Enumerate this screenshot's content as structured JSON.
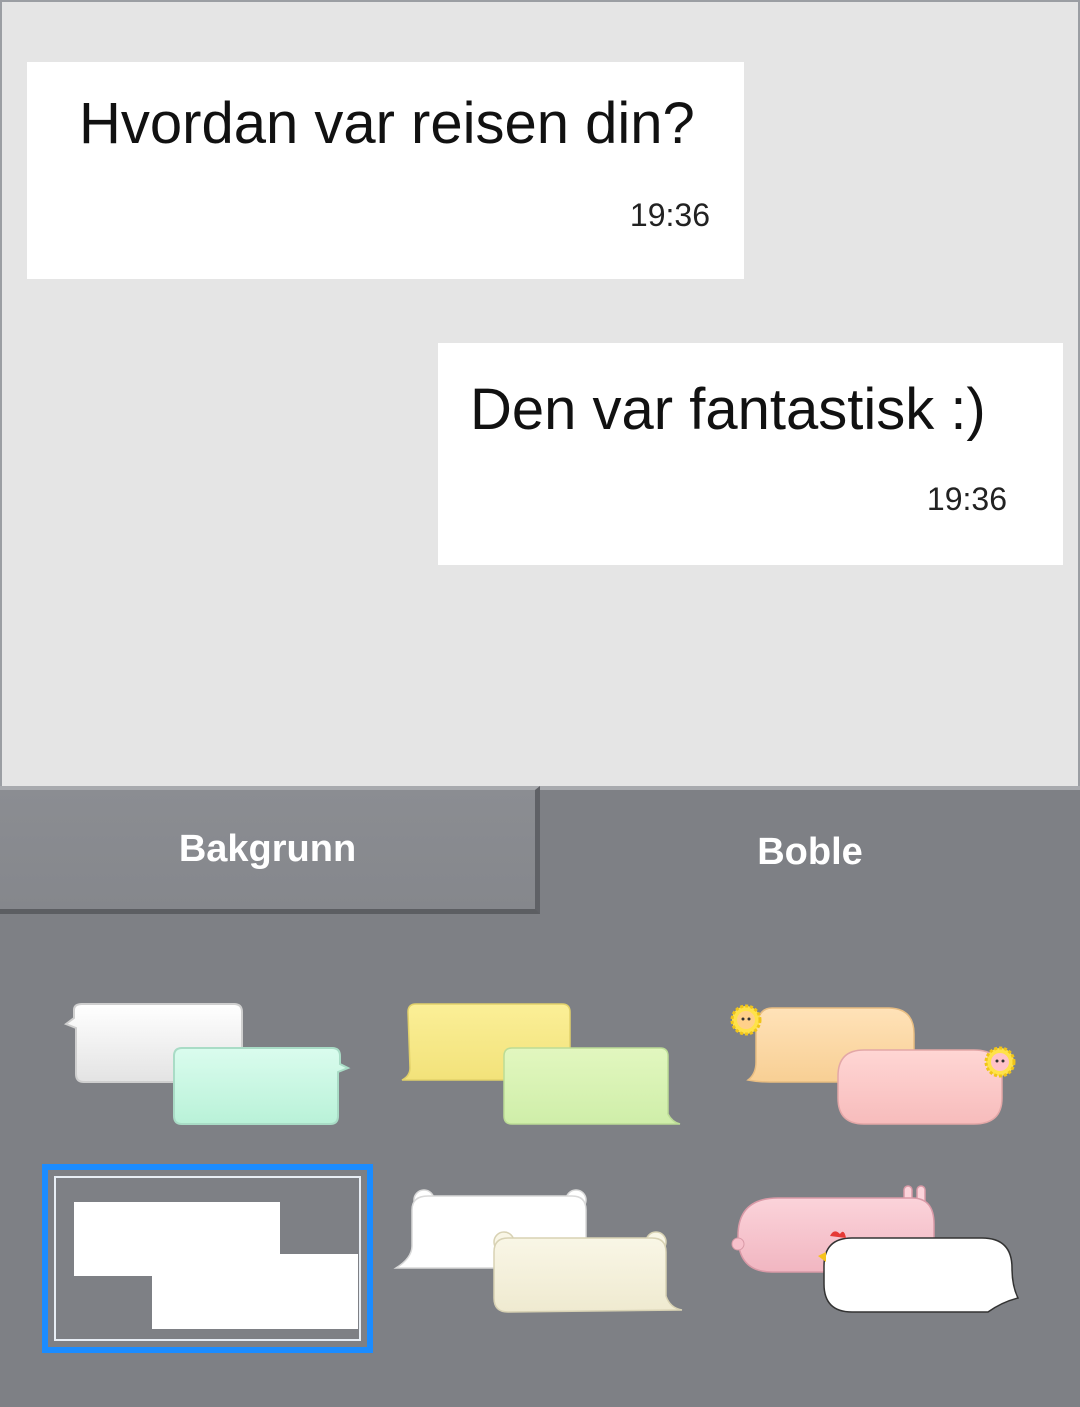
{
  "chat": {
    "messages": [
      {
        "text": "Hvordan var reisen din?",
        "time": "19:36"
      },
      {
        "text": "Den var fantastisk :)",
        "time": "19:36"
      }
    ]
  },
  "tabs": [
    {
      "label": "Bakgrunn",
      "active": true
    },
    {
      "label": "Boble",
      "active": false
    }
  ],
  "bubble_styles": [
    {
      "icon": "bubble-style-white-mint-icon"
    },
    {
      "icon": "bubble-style-yellow-green-icon"
    },
    {
      "icon": "bubble-style-orange-pink-lion-icon"
    },
    {
      "icon": "bubble-style-plain-white-icon",
      "selected": true
    },
    {
      "icon": "bubble-style-bear-cream-icon"
    },
    {
      "icon": "bubble-style-rabbit-chicken-icon"
    }
  ],
  "colors": {
    "preview_bg": "#e5e5e5",
    "panel_bg": "#7e8085",
    "selection": "#1b8cff"
  }
}
